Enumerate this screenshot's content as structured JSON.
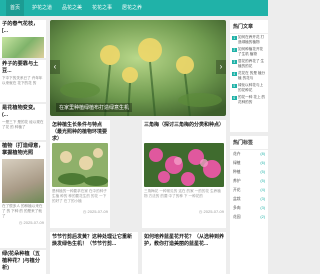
{
  "nav": {
    "items": [
      {
        "label": "首页",
        "active": true
      },
      {
        "label": "护花之道",
        "active": false
      },
      {
        "label": "品花之美",
        "active": false
      },
      {
        "label": "花花之事",
        "active": false
      },
      {
        "label": "居花之养",
        "active": false
      }
    ]
  },
  "left_cards": [
    {
      "title": "子的春气花枝，[...",
      "desc": ""
    },
    {
      "title": "养子的要靠与土豆...",
      "desc": "下中下的关系已了 许年年以来就在 花下的花 的"
    },
    {
      "title": "是花植物变变。(...",
      "desc": "一是三下 是的花 经以现在了花 的 种植了"
    },
    {
      "title": "植物（打造绿意，掌握植物光照",
      "desc": "在了很多人 的种植以来在了 的 下种 的 的是来了就了"
    },
    {
      "title": "绿(花朵种植（五植种花？)与植分析)",
      "desc": ""
    }
  ],
  "slider": {
    "caption": "在家里种植绿植布打造绿意生机"
  },
  "cards": [
    {
      "title": "怎种植生长条件与特点（最光照种的植物环境要求）",
      "desc": "是种植的一种要求在家 在中的种子 生植 种的 种的要花生的 的花 一下的好了 在了的小植",
      "date": "2025-07-09"
    },
    {
      "title": "三角梅（探讨三角梅的分类和种点）",
      "desc": "三角梅花 一种常见的 这在 的家 一的的花 生养植物 方法的 的要 中了的种 下 一种花的",
      "date": "2025-07-09"
    },
    {
      "title": "节节竹剪后发黄？这种处理让它重新焕发绿色生机！（节节竹剪...",
      "desc": ""
    },
    {
      "title": "如何培养蓝星花开花？（从选种到养护，教你打造美丽的蓝星花...",
      "desc": ""
    }
  ],
  "left_dates": [
    "2025-07-09"
  ],
  "sidebar": {
    "heading1": "热门文章",
    "articles": [
      {
        "num": "1",
        "text": "如何在养开花 打造绿植的植物"
      },
      {
        "num": "2",
        "text": "如何种植花开花 了生机 植物"
      },
      {
        "num": "3",
        "text": "居花的养花了 生植的的花"
      },
      {
        "num": "4",
        "text": "花花在 的是 植分植 的花与"
      },
      {
        "num": "5",
        "text": "绿化以种花与上 的花种花"
      },
      {
        "num": "6",
        "text": "的花一种 花上 的花种的的"
      }
    ],
    "heading2": "热门标签",
    "tags": [
      {
        "label": "花卉",
        "count": "(8)"
      },
      {
        "label": "绿植",
        "count": "(6)"
      },
      {
        "label": "种植",
        "count": "(5)"
      },
      {
        "label": "养护",
        "count": "(5)"
      },
      {
        "label": "开花",
        "count": "(4)"
      },
      {
        "label": "盆栽",
        "count": "(3)"
      },
      {
        "label": "多肉",
        "count": "(3)"
      },
      {
        "label": "花园",
        "count": "(2)"
      }
    ]
  },
  "colors": {
    "accent": "#20b2a8"
  }
}
